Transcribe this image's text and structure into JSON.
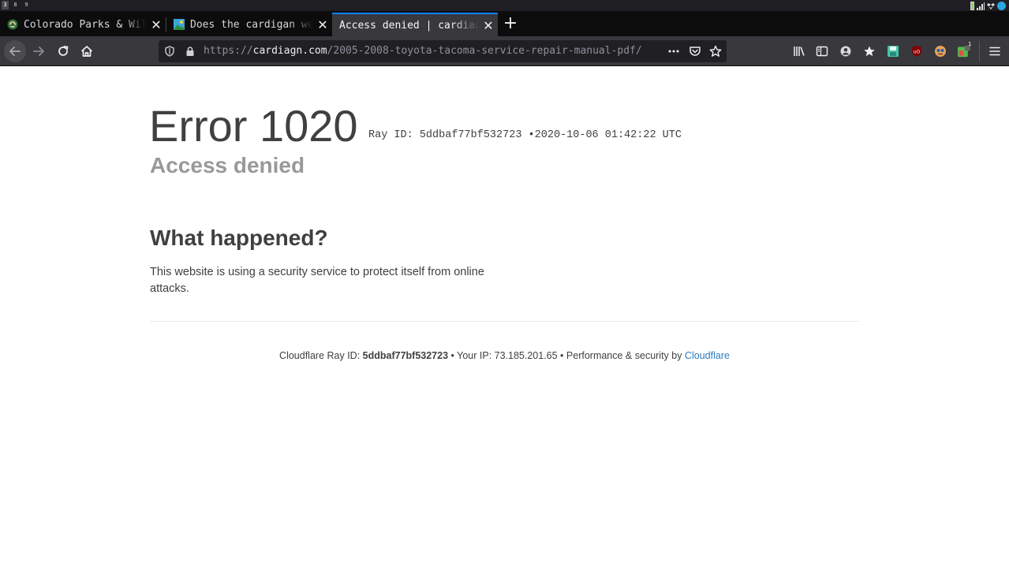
{
  "workspaces": [
    "3",
    "8",
    "9"
  ],
  "tabs": [
    {
      "title": "Colorado Parks & Wildlife",
      "favicon": "cpw-favicon",
      "selected": false
    },
    {
      "title": "Does the cardigan website",
      "favicon": "image-favicon",
      "selected": false
    },
    {
      "title": "Access denied | cardiagn.com",
      "favicon": "",
      "selected": true
    }
  ],
  "tab_close_glyph": "✕",
  "new_tab_glyph": "+",
  "urlbar": {
    "scheme": "https://",
    "host": "cardiagn.com",
    "path": "/2005-2008-toyota-tacoma-service-repair-manual-pdf/"
  },
  "extension_badge": "1",
  "page": {
    "error_title": "Error 1020",
    "ray_line": "Ray ID: 5ddbaf77bf532723 •2020-10-06 01:42:22 UTC",
    "subtitle": "Access denied",
    "what_heading": "What happened?",
    "what_text": "This website is using a security service to protect itself from online attacks.",
    "footer": {
      "ray_label": "Cloudflare Ray ID:",
      "ray_id": "5ddbaf77bf532723",
      "ip_text": "• Your IP: 73.185.201.65 • Performance & security by",
      "cf_link": "Cloudflare"
    }
  },
  "colors": {
    "accent": "#0a84ff",
    "link": "#2f7bbf",
    "text": "#404040",
    "muted": "#999999",
    "toolbar": "#38383d",
    "tabstrip": "#0c0c0d"
  }
}
